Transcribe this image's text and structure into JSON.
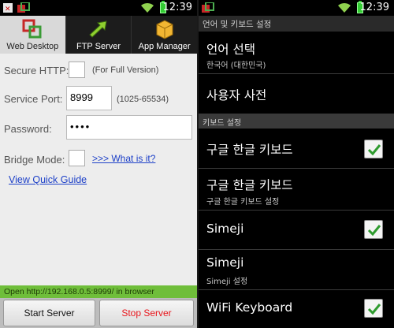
{
  "left": {
    "status": {
      "time": "12:39"
    },
    "tabs": [
      {
        "label": "Web Desktop",
        "icon": "web-desktop-icon"
      },
      {
        "label": "FTP Server",
        "icon": "ftp-arrows-icon"
      },
      {
        "label": "App Manager",
        "icon": "box-icon"
      }
    ],
    "secure_http": {
      "label": "Secure HTTP:",
      "hint": "(For Full Version)"
    },
    "service_port": {
      "label": "Service Port:",
      "value": "8999",
      "hint": "(1025-65534)"
    },
    "password": {
      "label": "Password:",
      "value": "••••"
    },
    "bridge_mode": {
      "label": "Bridge Mode:",
      "link": ">>> What is it?"
    },
    "quick_guide": "View Quick Guide",
    "url_bar": "Open http://192.168.0.5:8999/ in browser",
    "start_button": "Start Server",
    "stop_button": "Stop Server",
    "colors": {
      "stop_text": "#e8151b",
      "url_bar": "#6fbe3a",
      "link": "#1d40c8"
    }
  },
  "right": {
    "status": {
      "time": "12:39"
    },
    "title": "언어 및 키보드 설정",
    "items": [
      {
        "title": "언어 선택",
        "subtitle": "한국어 (대한민국)"
      },
      {
        "title": "사용자 사전"
      }
    ],
    "section_header": "키보드 설정",
    "keyboards": [
      {
        "title": "구글 한글 키보드",
        "checked": true
      },
      {
        "title": "구글 한글 키보드",
        "subtitle": "구글 한글 키보드 설정"
      },
      {
        "title": "Simeji",
        "checked": true
      },
      {
        "title": "Simeji",
        "subtitle": "Simeji 설정"
      },
      {
        "title": "WiFi Keyboard",
        "checked": true
      }
    ]
  }
}
